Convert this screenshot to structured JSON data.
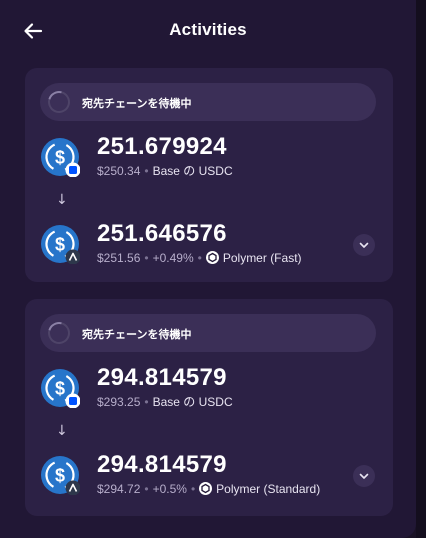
{
  "header": {
    "title": "Activities"
  },
  "activities": [
    {
      "status_text": "宛先チェーンを待機中",
      "from": {
        "amount": "251.679924",
        "value": "$250.34",
        "desc": "Base の USDC"
      },
      "to": {
        "amount": "251.646576",
        "value": "$251.56",
        "change": "+0.49%",
        "provider": "Polymer (Fast)"
      }
    },
    {
      "status_text": "宛先チェーンを待機中",
      "from": {
        "amount": "294.814579",
        "value": "$293.25",
        "desc": "Base の USDC"
      },
      "to": {
        "amount": "294.814579",
        "value": "$294.72",
        "change": "+0.5%",
        "provider": "Polymer (Standard)"
      }
    }
  ],
  "separator": "•",
  "arrow": "↓",
  "icons": {
    "back": "arrow-left-icon",
    "token": "usdc-icon",
    "chain_from": "base-chain-icon",
    "chain_to": "arbitrum-chain-icon",
    "provider": "polymer-icon",
    "expand": "chevron-down-icon",
    "status": "spinner-icon"
  },
  "colors": {
    "background": "#211735",
    "card": "#2c2145",
    "status_pill": "#3b2f57",
    "usdc_blue": "#2775ca",
    "base_blue": "#0052ff",
    "muted_text": "#b7aecb"
  }
}
